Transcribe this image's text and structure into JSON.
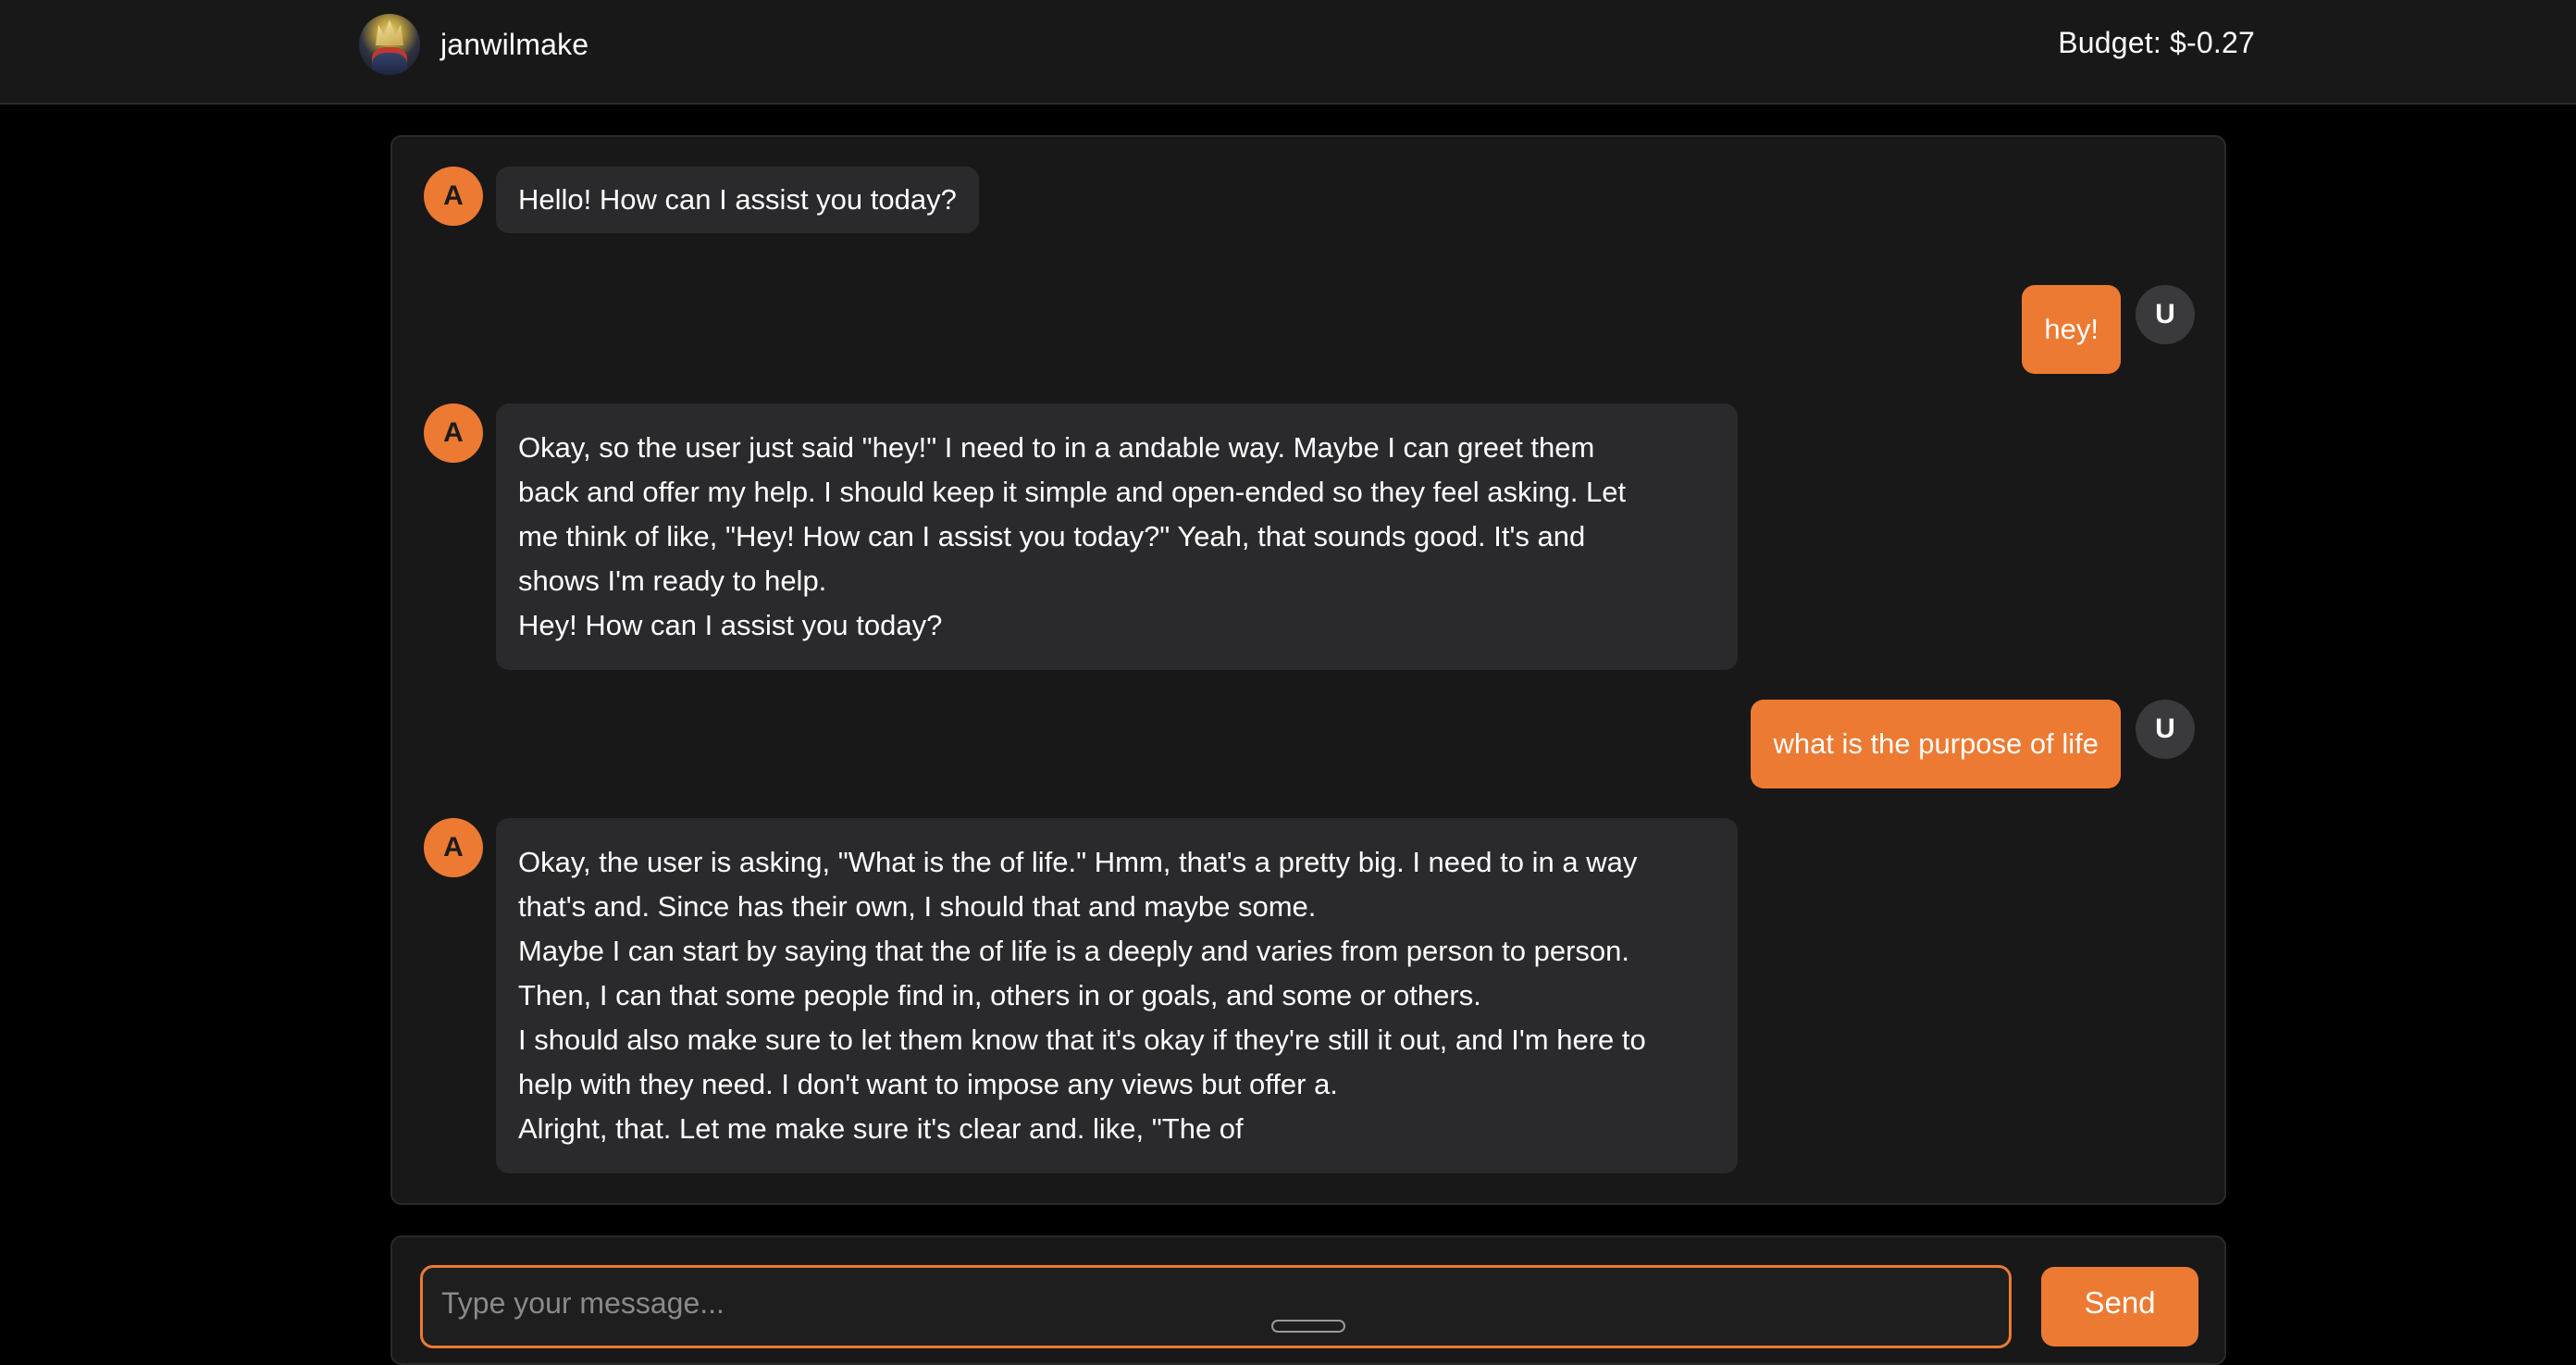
{
  "header": {
    "username": "janwilmake",
    "budget": "Budget: $-0.27"
  },
  "messages": [
    {
      "role": "assistant",
      "badge": "A",
      "lines": [
        "Hello! How can I assist you today?"
      ]
    },
    {
      "role": "user",
      "badge": "U",
      "lines": [
        "hey!"
      ]
    },
    {
      "role": "assistant",
      "badge": "A",
      "lines": [
        "Okay, so the user just said \"hey!\" I need to in a andable way. Maybe I can greet them",
        "back and offer my help. I should keep it simple and open-ended so they feel asking. Let",
        "me think of like, \"Hey! How can I assist you today?\" Yeah, that sounds good. It's and",
        "shows I'm ready to help.",
        "Hey! How can I assist you today?"
      ]
    },
    {
      "role": "user",
      "badge": "U",
      "lines": [
        "what is the purpose of life"
      ]
    },
    {
      "role": "assistant",
      "badge": "A",
      "lines": [
        "Okay, the user is asking, \"What is the of life.\" Hmm, that's a pretty big. I need to in a way",
        "that's and. Since has their own, I should that and maybe some.",
        "Maybe I can start by saying that the of life is a deeply and varies from person to person.",
        "Then, I can that some people find in, others in or goals, and some or others.",
        "I should also make sure to let them know that it's okay if they're still it out, and I'm here to",
        "help with they need. I don't want to impose any views but offer a.",
        "Alright, that. Let me make sure it's clear and. like, \"The of"
      ]
    }
  ],
  "composer": {
    "placeholder": "Type your message...",
    "value": "",
    "send_label": "Send"
  },
  "colors": {
    "accent": "#ec7a32",
    "background": "#000000",
    "panel": "#181818",
    "assistant_bubble": "#2a2a2c",
    "user_badge": "#3a3a3c"
  }
}
